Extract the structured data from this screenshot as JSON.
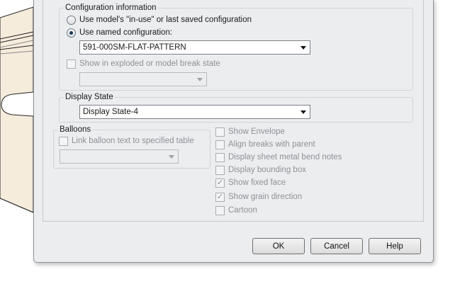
{
  "configuration": {
    "title": "Configuration information",
    "option_in_use": "Use model's \"in-use\" or last saved configuration",
    "option_named": "Use named configuration:",
    "named_selected": true,
    "named_value": "591-000SM-FLAT-PATTERN",
    "exploded_label": "Show in exploded or model break state",
    "exploded_value": ""
  },
  "display_state": {
    "title": "Display State",
    "value": "Display State-4"
  },
  "balloons": {
    "title": "Balloons",
    "link_label": "Link balloon text to specified table",
    "table_value": ""
  },
  "options": [
    {
      "label": "Show Envelope",
      "checked": false
    },
    {
      "label": "Align breaks with parent",
      "checked": false
    },
    {
      "label": "Display sheet metal bend notes",
      "checked": false
    },
    {
      "label": "Display bounding box",
      "checked": false
    },
    {
      "label": "Show fixed face",
      "checked": true
    },
    {
      "label": "Show grain direction",
      "checked": true
    },
    {
      "label": "Cartoon",
      "checked": false
    }
  ],
  "buttons": {
    "ok": "OK",
    "cancel": "Cancel",
    "help": "Help"
  },
  "colors": {
    "dialog_bg": "#ecedef",
    "part_fill": "#f6ecdc"
  }
}
